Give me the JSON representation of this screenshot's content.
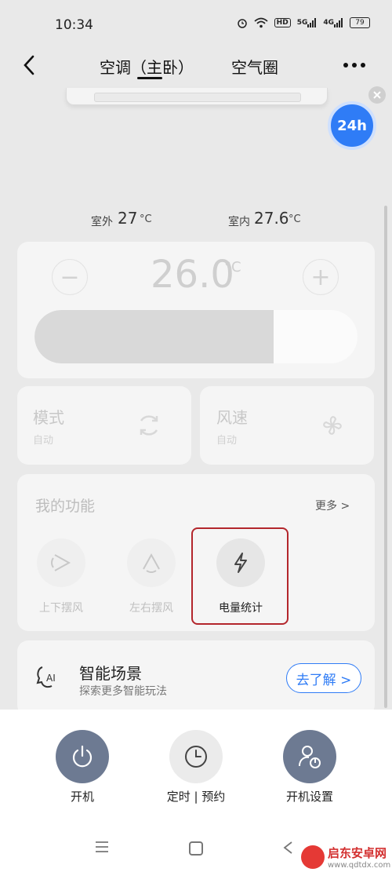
{
  "status_bar": {
    "time": "10:34",
    "signal_a": "5G",
    "signal_b": "4G",
    "hd_badge": "HD",
    "battery": "79"
  },
  "header": {
    "tab_active": "空调（主卧）",
    "tab_other": "空气圈"
  },
  "badge": {
    "label": "24h"
  },
  "temps": {
    "outdoor_label": "室外",
    "outdoor_value": "27",
    "outdoor_unit": "°C",
    "indoor_label": "室内",
    "indoor_value": "27.6",
    "indoor_unit": "°C"
  },
  "control": {
    "set_temp": "26.0",
    "set_unit": "°C",
    "minus": "−",
    "plus": "+",
    "slider_fraction": 0.74
  },
  "mode": {
    "title": "模式",
    "value": "自动"
  },
  "wind": {
    "title": "风速",
    "value": "自动"
  },
  "functions": {
    "title": "我的功能",
    "more": "更多 >",
    "items": [
      {
        "label": "上下摆风"
      },
      {
        "label": "左右摆风"
      },
      {
        "label": "电量统计"
      }
    ]
  },
  "scene": {
    "title": "智能场景",
    "subtitle": "探索更多智能玩法",
    "button": "去了解 >"
  },
  "actions": [
    {
      "label": "开机"
    },
    {
      "label": "定时 | 预约"
    },
    {
      "label": "开机设置"
    }
  ],
  "watermark": {
    "name": "启东安卓网",
    "url": "www.qdtdx.com"
  },
  "colors": {
    "accent": "#2f7cf6",
    "highlight": "#b3262c",
    "action": "#6d7a92"
  }
}
